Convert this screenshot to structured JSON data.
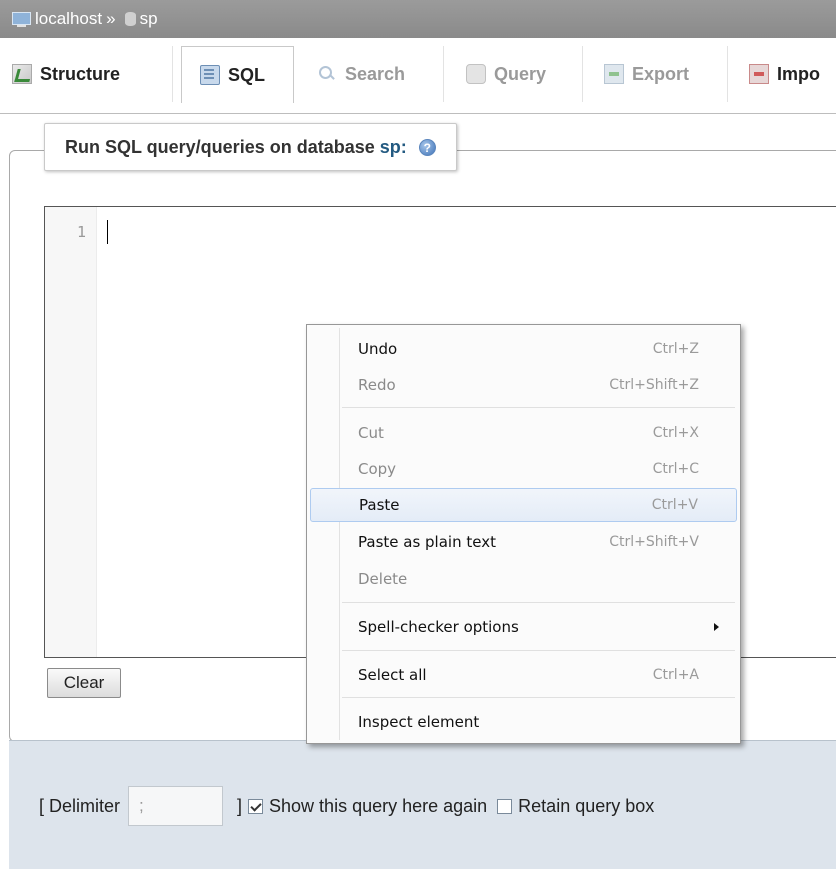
{
  "breadcrumb": {
    "server": "localhost",
    "separator": "»",
    "database": "sp"
  },
  "tabs": [
    {
      "label": "Structure",
      "icon": "structure-icon",
      "state": "normal"
    },
    {
      "label": "SQL",
      "icon": "sql-icon",
      "state": "active"
    },
    {
      "label": "Search",
      "icon": "search-icon",
      "state": "disabled"
    },
    {
      "label": "Query",
      "icon": "query-icon",
      "state": "disabled"
    },
    {
      "label": "Export",
      "icon": "export-icon",
      "state": "disabled"
    },
    {
      "label": "Impo",
      "icon": "import-icon",
      "state": "normal"
    }
  ],
  "sql_panel": {
    "legend_text": "Run SQL query/queries on database",
    "database": "sp:",
    "line_number": "1",
    "clear_label": "Clear"
  },
  "bottom": {
    "delimiter_open": "[ Delimiter",
    "delimiter_value": ";",
    "delimiter_close": "]",
    "show_query_label": "Show this query here again",
    "show_query_checked": true,
    "retain_label": "Retain query box",
    "retain_checked": false
  },
  "context_menu": {
    "items": [
      {
        "label": "Undo",
        "shortcut": "Ctrl+Z",
        "disabled": false
      },
      {
        "label": "Redo",
        "shortcut": "Ctrl+Shift+Z",
        "disabled": true
      },
      {
        "label": "Cut",
        "shortcut": "Ctrl+X",
        "disabled": true
      },
      {
        "label": "Copy",
        "shortcut": "Ctrl+C",
        "disabled": true
      },
      {
        "label": "Paste",
        "shortcut": "Ctrl+V",
        "disabled": false,
        "hover": true
      },
      {
        "label": "Paste as plain text",
        "shortcut": "Ctrl+Shift+V",
        "disabled": false
      },
      {
        "label": "Delete",
        "shortcut": "",
        "disabled": true
      },
      {
        "label": "Spell-checker options",
        "shortcut": "",
        "disabled": false,
        "submenu": true
      },
      {
        "label": "Select all",
        "shortcut": "Ctrl+A",
        "disabled": false
      },
      {
        "label": "Inspect element",
        "shortcut": "",
        "disabled": false
      }
    ]
  },
  "colors": {
    "accent": "#235a81",
    "breadcrumb_bg": "#9b9b9b",
    "bottom_bg": "#dde4ec"
  }
}
